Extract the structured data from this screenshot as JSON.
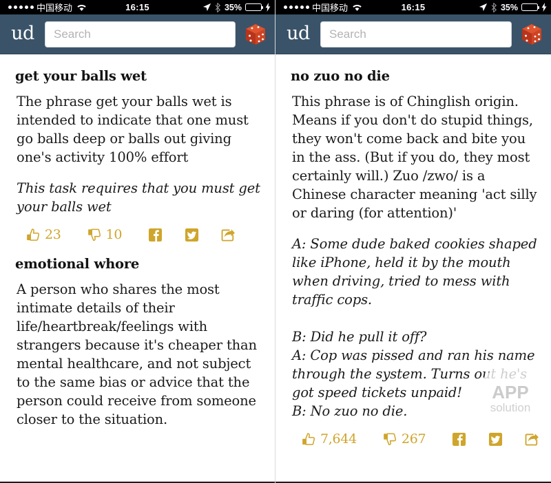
{
  "status_bar": {
    "signal_dots": 5,
    "carrier": "中国移动",
    "wifi_icon": "wifi-icon",
    "time": "16:15",
    "location_icon": "location-arrow-icon",
    "bluetooth_icon": "bluetooth-icon",
    "battery_percent": "35%",
    "battery_level": 35,
    "charging_icon": "lightning-bolt-icon"
  },
  "nav": {
    "logo_text": "ud",
    "search_placeholder": "Search",
    "search_value": "",
    "random_icon": "dice-icon"
  },
  "colors": {
    "nav_background": "#3a5369",
    "accent_gold": "#cfa52b",
    "status_background": "#000000",
    "battery_green": "#4cd964",
    "dice_red": "#c0391b"
  },
  "screens": [
    {
      "id": "left",
      "entries": [
        {
          "term": "get your balls wet",
          "definition": "The phrase get your balls wet is intended to indicate that one must go balls deep or balls out giving one's activity 100% effort",
          "example": "This task requires that you must get your balls wet",
          "actions": {
            "thumbs_up_label": "23",
            "thumbs_down_label": "10",
            "facebook_icon": "facebook-icon",
            "twitter_icon": "twitter-icon",
            "share_icon": "share-icon"
          }
        },
        {
          "term": "emotional whore",
          "definition": "A person who shares the most intimate details of their life/heartbreak/feelings with strangers because it's cheaper than mental healthcare, and not subject to the same bias or advice that the person could receive from someone closer to the situation.",
          "example": "",
          "actions": null
        }
      ]
    },
    {
      "id": "right",
      "entries": [
        {
          "term": "no zuo no die",
          "definition": "This phrase is of Chinglish origin. Means if you don't do stupid things, they won't come back and bite you in the ass. (But if you do, they most certainly will.) Zuo /zwo/ is a Chinese character meaning 'act silly or daring (for attention)'",
          "example": "A: Some dude baked cookies shaped like iPhone, held it by the mouth when driving, tried to mess with traffic cops.\n\nB: Did he pull it off?\nA: Cop was pissed and ran his name through the system. Turns out he's got speed tickets unpaid!\nB: No zuo no die.",
          "actions": {
            "thumbs_up_label": "7,644",
            "thumbs_down_label": "267",
            "facebook_icon": "facebook-icon",
            "twitter_icon": "twitter-icon",
            "share_icon": "share-icon"
          }
        }
      ],
      "watermark": {
        "line1": "APP",
        "line2": "solution"
      }
    }
  ]
}
